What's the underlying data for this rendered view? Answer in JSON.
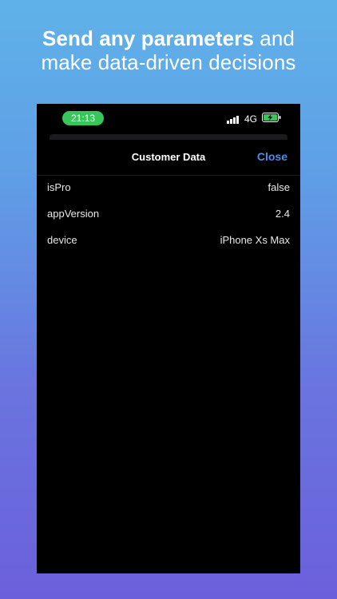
{
  "headline": {
    "bold_part": "Send any parameters",
    "rest_line1": " and",
    "line2": "make data-driven decisions"
  },
  "status_bar": {
    "time": "21:13",
    "network": "4G",
    "time_pill_color": "#35c759"
  },
  "nav": {
    "title": "Customer Data",
    "close_label": "Close",
    "accent_color": "#4d8ce8"
  },
  "rows": [
    {
      "key": "isPro",
      "value": "false"
    },
    {
      "key": "appVersion",
      "value": "2.4"
    },
    {
      "key": "device",
      "value": "iPhone Xs Max"
    }
  ],
  "icons": {
    "signal": "signal-bars-icon",
    "battery": "battery-charging-icon"
  }
}
